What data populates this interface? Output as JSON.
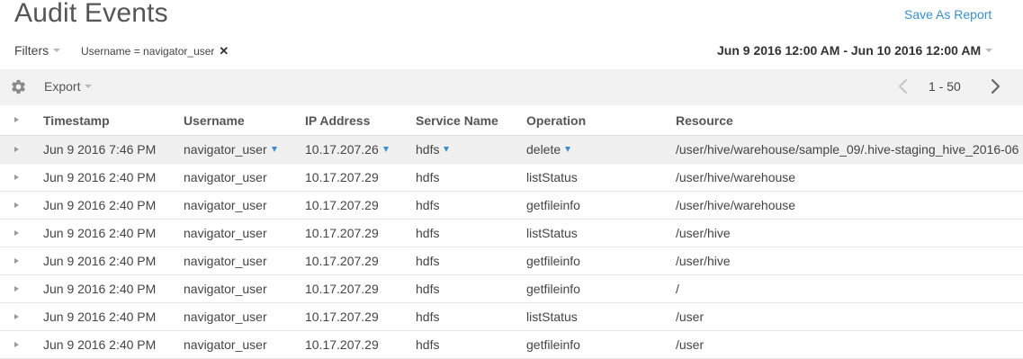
{
  "page": {
    "title": "Audit Events",
    "save_report": "Save As Report"
  },
  "filters": {
    "label": "Filters",
    "active": "Username = navigator_user",
    "close_glyph": "✕",
    "date_range": "Jun 9 2016 12:00 AM - Jun 10 2016 12:00 AM"
  },
  "toolbar": {
    "export_label": "Export",
    "pager_range": "1 - 50"
  },
  "table": {
    "columns": [
      "Timestamp",
      "Username",
      "IP Address",
      "Service Name",
      "Operation",
      "Resource"
    ],
    "rows": [
      [
        "Jun 9 2016 7:46 PM",
        "navigator_user",
        "10.17.207.26",
        "hdfs",
        "delete",
        "/user/hive/warehouse/sample_09/.hive-staging_hive_2016-06"
      ],
      [
        "Jun 9 2016 2:40 PM",
        "navigator_user",
        "10.17.207.29",
        "hdfs",
        "listStatus",
        "/user/hive/warehouse"
      ],
      [
        "Jun 9 2016 2:40 PM",
        "navigator_user",
        "10.17.207.29",
        "hdfs",
        "getfileinfo",
        "/user/hive/warehouse"
      ],
      [
        "Jun 9 2016 2:40 PM",
        "navigator_user",
        "10.17.207.29",
        "hdfs",
        "listStatus",
        "/user/hive"
      ],
      [
        "Jun 9 2016 2:40 PM",
        "navigator_user",
        "10.17.207.29",
        "hdfs",
        "getfileinfo",
        "/user/hive"
      ],
      [
        "Jun 9 2016 2:40 PM",
        "navigator_user",
        "10.17.207.29",
        "hdfs",
        "getfileinfo",
        "/"
      ],
      [
        "Jun 9 2016 2:40 PM",
        "navigator_user",
        "10.17.207.29",
        "hdfs",
        "listStatus",
        "/user"
      ],
      [
        "Jun 9 2016 2:40 PM",
        "navigator_user",
        "10.17.207.29",
        "hdfs",
        "getfileinfo",
        "/user"
      ]
    ],
    "selected_row": 0
  },
  "colors": {
    "accent": "#3a8ed0",
    "toolbar_bg": "#f2f2f2",
    "selected_row_bg": "#f0f0f0"
  },
  "icons": {
    "settings": "gear-icon",
    "prev_page": "chevron-left-icon",
    "next_page": "chevron-right-icon",
    "row_expand": "caret-right-icon",
    "column_filter": "funnel-icon",
    "remove_filter": "close-icon",
    "dropdown": "caret-down-icon"
  }
}
